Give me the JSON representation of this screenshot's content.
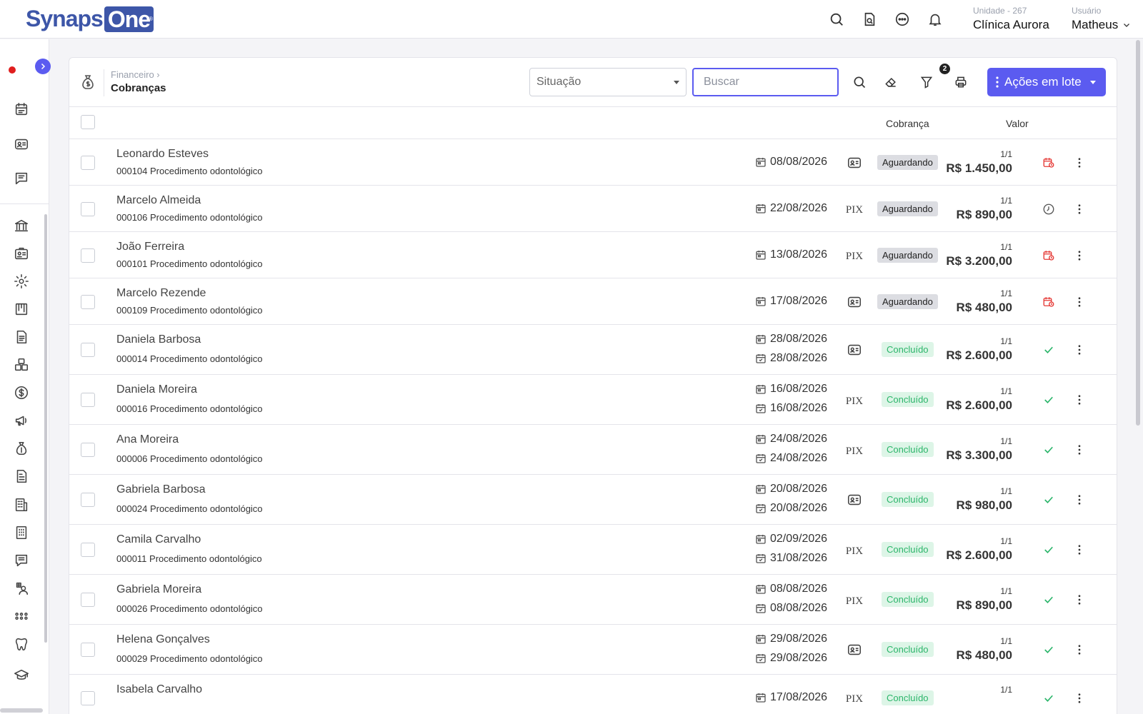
{
  "logo": {
    "part1": "Synaps",
    "part2": "One",
    "reg": "®"
  },
  "header": {
    "unit_label": "Unidade - 267",
    "unit_value": "Clínica Aurora",
    "user_label": "Usuário",
    "user_value": "Matheus"
  },
  "page": {
    "breadcrumb_parent": "Financeiro ›",
    "title": "Cobranças",
    "status_select": "Situação",
    "search_placeholder": "Buscar",
    "filter_badge": "2",
    "bulk_actions": "Ações em lote"
  },
  "table": {
    "col_cobranca": "Cobrança",
    "col_valor": "Valor",
    "rows": [
      {
        "name": "Leonardo Esteves",
        "desc": "000104 Procedimento odontológico",
        "date1": "08/08/2026",
        "date2": "",
        "pay": "card",
        "status": "Aguardando",
        "parcel": "1/1",
        "amount": "R$ 1.450,00",
        "state": "overdue"
      },
      {
        "name": "Marcelo Almeida",
        "desc": "000106 Procedimento odontológico",
        "date1": "22/08/2026",
        "date2": "",
        "pay": "pix",
        "status": "Aguardando",
        "parcel": "1/1",
        "amount": "R$ 890,00",
        "state": "pending"
      },
      {
        "name": "João Ferreira",
        "desc": "000101 Procedimento odontológico",
        "date1": "13/08/2026",
        "date2": "",
        "pay": "pix",
        "status": "Aguardando",
        "parcel": "1/1",
        "amount": "R$ 3.200,00",
        "state": "overdue"
      },
      {
        "name": "Marcelo Rezende",
        "desc": "000109 Procedimento odontológico",
        "date1": "17/08/2026",
        "date2": "",
        "pay": "card",
        "status": "Aguardando",
        "parcel": "1/1",
        "amount": "R$ 480,00",
        "state": "overdue"
      },
      {
        "name": "Daniela Barbosa",
        "desc": "000014 Procedimento odontológico",
        "date1": "28/08/2026",
        "date2": "28/08/2026",
        "pay": "card",
        "status": "Concluído",
        "parcel": "1/1",
        "amount": "R$ 2.600,00",
        "state": "done"
      },
      {
        "name": "Daniela Moreira",
        "desc": "000016 Procedimento odontológico",
        "date1": "16/08/2026",
        "date2": "16/08/2026",
        "pay": "pix",
        "status": "Concluído",
        "parcel": "1/1",
        "amount": "R$ 2.600,00",
        "state": "done"
      },
      {
        "name": "Ana Moreira",
        "desc": "000006 Procedimento odontológico",
        "date1": "24/08/2026",
        "date2": "24/08/2026",
        "pay": "pix",
        "status": "Concluído",
        "parcel": "1/1",
        "amount": "R$ 3.300,00",
        "state": "done"
      },
      {
        "name": "Gabriela Barbosa",
        "desc": "000024 Procedimento odontológico",
        "date1": "20/08/2026",
        "date2": "20/08/2026",
        "pay": "card",
        "status": "Concluído",
        "parcel": "1/1",
        "amount": "R$ 980,00",
        "state": "done"
      },
      {
        "name": "Camila Carvalho",
        "desc": "000011 Procedimento odontológico",
        "date1": "02/09/2026",
        "date2": "31/08/2026",
        "pay": "pix",
        "status": "Concluído",
        "parcel": "1/1",
        "amount": "R$ 2.600,00",
        "state": "done"
      },
      {
        "name": "Gabriela Moreira",
        "desc": "000026 Procedimento odontológico",
        "date1": "08/08/2026",
        "date2": "08/08/2026",
        "pay": "pix",
        "status": "Concluído",
        "parcel": "1/1",
        "amount": "R$ 890,00",
        "state": "done"
      },
      {
        "name": "Helena Gonçalves",
        "desc": "000029 Procedimento odontológico",
        "date1": "29/08/2026",
        "date2": "29/08/2026",
        "pay": "card",
        "status": "Concluído",
        "parcel": "1/1",
        "amount": "R$ 480,00",
        "state": "done"
      },
      {
        "name": "Isabela Carvalho",
        "desc": "",
        "date1": "17/08/2026",
        "date2": "",
        "pay": "pix",
        "status": "Concluído",
        "parcel": "1/1",
        "amount": "",
        "state": "done"
      }
    ]
  },
  "pix_label": "PIX",
  "colors": {
    "accent": "#5b5bf0",
    "brand": "#3d56a8",
    "success": "#2bb56a",
    "danger": "#e53935"
  },
  "sidebar_icons": [
    "calendar-icon",
    "id-card-icon",
    "chat-icon",
    "bank-icon",
    "badge-icon",
    "gear-icon",
    "kanban-icon",
    "document-icon",
    "boxes-icon",
    "dollar-icon",
    "megaphone-icon",
    "money-bag-icon",
    "report-icon",
    "building-icon",
    "building-alt-icon",
    "message-icon",
    "medical-user-icon",
    "apps-grid-icon",
    "tooth-icon",
    "graduation-cap-icon"
  ]
}
